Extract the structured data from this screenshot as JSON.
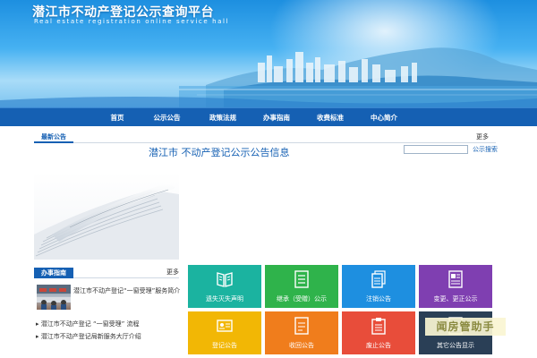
{
  "banner": {
    "title": "潜江市不动产登记公示查询平台",
    "subtitle": "Real estate registration online service hall"
  },
  "nav": {
    "items": [
      "首页",
      "公示公告",
      "政策法规",
      "办事指南",
      "收费标准",
      "中心简介"
    ]
  },
  "news": {
    "tab_label": "最新公告",
    "more_label": "更多",
    "notice_title": "潜江市 不动产登记公示公告信息",
    "search_placeholder": "",
    "search_link": "公示搜索"
  },
  "guide": {
    "tab_label": "办事指南",
    "more_label": "更多",
    "photo_caption": "潜江市不动产登记“一窗受理”服务简介",
    "links": [
      "潜江市不动产登记 “一窗受理” 流程",
      "潜江市不动产登记局新服务大厅介绍"
    ]
  },
  "tiles": [
    {
      "label": "遗失灭失声明",
      "color": "#1bb3a0",
      "icon": "open-book-icon"
    },
    {
      "label": "继承（受赠）公示",
      "color": "#2fb34b",
      "icon": "list-document-icon"
    },
    {
      "label": "注销公告",
      "color": "#1e8fe0",
      "icon": "stacked-documents-icon"
    },
    {
      "label": "变更、更正公示",
      "color": "#7f3fb1",
      "icon": "newspaper-icon"
    },
    {
      "label": "登记公告",
      "color": "#f2b705",
      "icon": "id-card-icon"
    },
    {
      "label": "收回公告",
      "color": "#f07d1c",
      "icon": "retract-document-icon"
    },
    {
      "label": "废止公告",
      "color": "#e84d3a",
      "icon": "clipboard-icon"
    },
    {
      "label": "其它公告显示",
      "color": "#2a3f56",
      "icon": "other-notice-icon"
    }
  ],
  "watermark": "闻房管助手",
  "colors": {
    "nav": "#1560b3",
    "accent": "#1560b3"
  }
}
